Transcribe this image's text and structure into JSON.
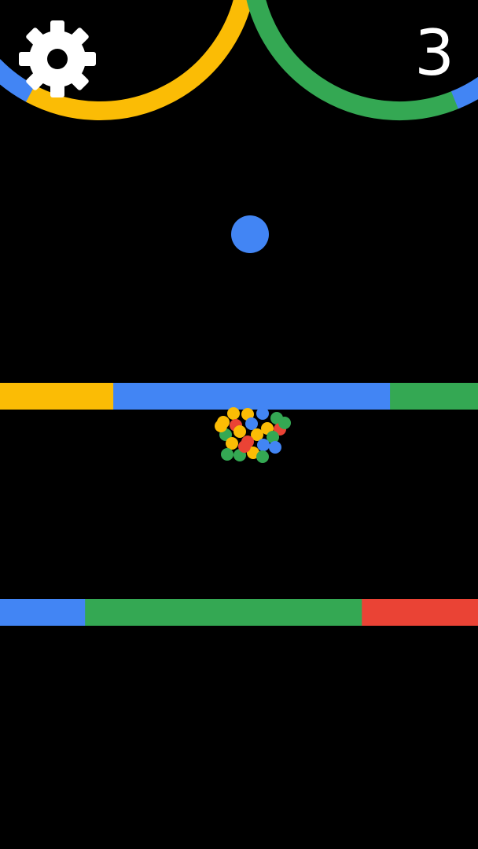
{
  "game": {
    "background_color": "#000000",
    "score": "3"
  },
  "hud": {
    "settings_icon": "gear-icon",
    "settings_color": "#ffffff",
    "score_color": "#ffffff"
  },
  "palette": {
    "yellow": "#fbbc05",
    "blue": "#4285f4",
    "green": "#34a853",
    "red": "#ea4335"
  },
  "player_ball": {
    "color": "#4285f4"
  },
  "obstacles": {
    "top_arcs": {
      "left_ring_colors": [
        "blue",
        "yellow",
        "red"
      ],
      "right_ring_colors": [
        "red",
        "green",
        "blue"
      ]
    },
    "bar_upper": {
      "segments": [
        {
          "color": "yellow",
          "fraction": 0.237
        },
        {
          "color": "blue",
          "fraction": 0.579
        },
        {
          "color": "green",
          "fraction": 0.184
        }
      ]
    },
    "bar_lower": {
      "segments": [
        {
          "color": "blue",
          "fraction": 0.178
        },
        {
          "color": "green",
          "fraction": 0.579
        },
        {
          "color": "red",
          "fraction": 0.243
        }
      ]
    }
  },
  "burst": {
    "colors": [
      "yellow",
      "blue",
      "green",
      "red"
    ]
  }
}
